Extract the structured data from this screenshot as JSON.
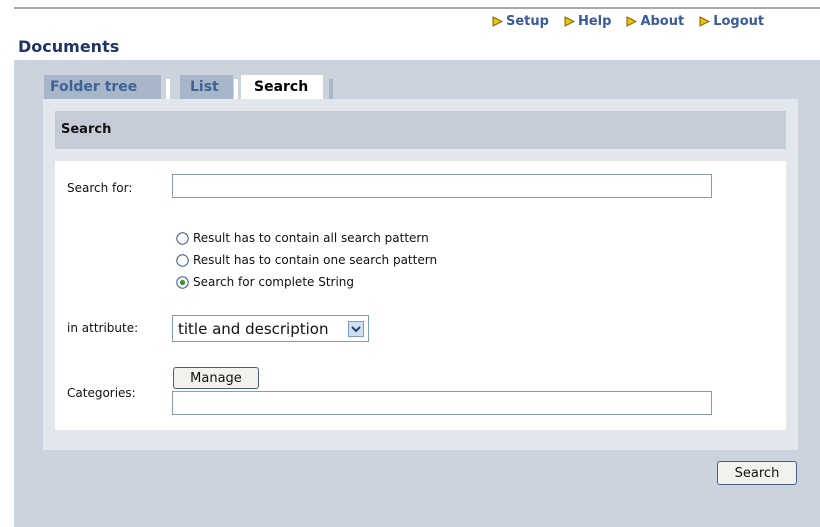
{
  "top_nav": [
    {
      "label": "Setup"
    },
    {
      "label": "Help"
    },
    {
      "label": "About"
    },
    {
      "label": "Logout"
    }
  ],
  "page_title": "Documents",
  "tabs": [
    {
      "label": "Folder tree",
      "active": false
    },
    {
      "label": "List",
      "active": false
    },
    {
      "label": "Search",
      "active": true
    }
  ],
  "section_title": "Search",
  "form": {
    "search_for": {
      "label": "Search for:",
      "value": ""
    },
    "match_options": [
      {
        "label": "Result has to contain all search pattern",
        "selected": false
      },
      {
        "label": "Result has to contain one search pattern",
        "selected": false
      },
      {
        "label": "Search for complete String",
        "selected": true
      }
    ],
    "attribute": {
      "label": "in attribute:",
      "selected": "title and description"
    },
    "categories": {
      "label": "Categories:",
      "manage_label": "Manage",
      "value": ""
    }
  },
  "submit_label": "Search",
  "colors": {
    "nav_arrow": "#f2c200",
    "nav_text": "#3b5a9a",
    "panel_bg": "#cbd3de",
    "tab_inactive": "#a8b6c9"
  },
  "icons": {
    "nav": "arrow-right-icon",
    "select": "chevron-down-icon"
  }
}
